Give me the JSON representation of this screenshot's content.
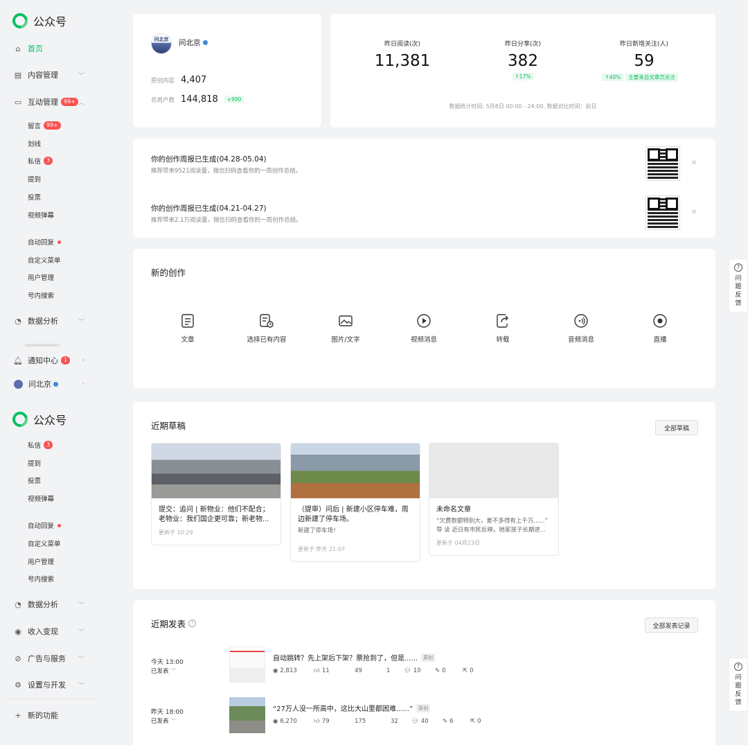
{
  "brand": {
    "name": "公众号"
  },
  "sidebar": {
    "home": "首页",
    "content_mgmt": "内容管理",
    "interaction": {
      "label": "互动管理",
      "badge": "99+"
    },
    "sub1": [
      {
        "label": "留言",
        "badge": "99+"
      },
      {
        "label": "划线"
      },
      {
        "label": "私信",
        "badge": "3"
      },
      {
        "label": "提到"
      },
      {
        "label": "投票"
      },
      {
        "label": "视频弹幕"
      }
    ],
    "sub2": [
      {
        "label": "自动回复",
        "dot": true
      },
      {
        "label": "自定义菜单"
      },
      {
        "label": "用户管理"
      },
      {
        "label": "号内搜索"
      }
    ],
    "data_analysis": "数据分析",
    "notify": {
      "label": "通知中心",
      "badge": "1"
    },
    "account": "问北京",
    "sub3": [
      {
        "label": "私信",
        "badge": "3"
      },
      {
        "label": "提到"
      },
      {
        "label": "投票"
      },
      {
        "label": "视频弹幕"
      }
    ],
    "sub4": [
      {
        "label": "自动回复",
        "dot": true
      },
      {
        "label": "自定义菜单"
      },
      {
        "label": "用户管理"
      },
      {
        "label": "号内搜索"
      }
    ],
    "data_analysis2": "数据分析",
    "monetize": "收入变现",
    "ads": "广告与服务",
    "settings": "设置与开发",
    "new_feature": "新的功能"
  },
  "profile": {
    "name": "问北京",
    "avatar_text": "问北京",
    "original_label": "原创内容",
    "original_value": "4,407",
    "users_label": "总用户数",
    "users_value": "144,818",
    "users_delta": "+990"
  },
  "stats": [
    {
      "title": "昨日阅读(次)",
      "value": "11,381"
    },
    {
      "title": "昨日分享(次)",
      "value": "382",
      "tag": "↑17%"
    },
    {
      "title": "昨日新增关注(人)",
      "value": "59",
      "tag": "↑40%",
      "tag2": "主要来自文章页关注"
    }
  ],
  "stats_note": "数据统计时间: 5月8日 00:00 - 24:00, 数据对比时间：前日",
  "reports": [
    {
      "title": "你的创作周报已生成(04.28-05.04)",
      "desc": "推荐带来9521阅读量，微信扫码查看你的一周创作总结。"
    },
    {
      "title": "你的创作周报已生成(04.21-04.27)",
      "desc": "推荐带来2.1万阅读量，微信扫码查看你的一周创作总结。"
    }
  ],
  "create": {
    "title": "新的创作",
    "tools": [
      "文章",
      "选择已有内容",
      "图片/文字",
      "视频消息",
      "转载",
      "音频消息",
      "直播"
    ]
  },
  "drafts": {
    "title": "近期草稿",
    "all_btn": "全部草稿",
    "items": [
      {
        "title": "提交：追问 | 新物业：他们不配合；老物业：我们国企更可靠；新老物...",
        "desc": "",
        "updated": "更新于 10:29"
      },
      {
        "title": "（提审）问后 | 新建小区停车难，周边新建了停车场。",
        "desc": "新建了停车场！",
        "updated": "更新于 昨天 21:07"
      },
      {
        "title": "未命名文章",
        "desc": "“欠费数额特别大，差不多得有上千万......” 导 读 近日有市民反映，她家孩子长期进...",
        "updated": "更新于 04月23日"
      }
    ]
  },
  "published": {
    "title": "近期发表",
    "all_btn": "全部发表记录",
    "items": [
      {
        "time": "今天 13:00",
        "status": "已发表",
        "title": "自动跳转？先上架后下架？票抢到了，但是......",
        "tag": "原创",
        "reads": "2,813",
        "likes": "11",
        "m3": "49",
        "m4": "1",
        "comments": "10",
        "edits": "0",
        "shares": "0"
      },
      {
        "time": "昨天 18:00",
        "status": "已发表",
        "title": "“27万人没一所高中，这比大山里都困难......”",
        "tag": "原创",
        "reads": "6,270",
        "likes": "79",
        "m3": "175",
        "m4": "32",
        "comments": "40",
        "edits": "6",
        "shares": "0"
      }
    ]
  },
  "feedback": {
    "label_chars": [
      "问",
      "题",
      "反",
      "馈"
    ]
  }
}
